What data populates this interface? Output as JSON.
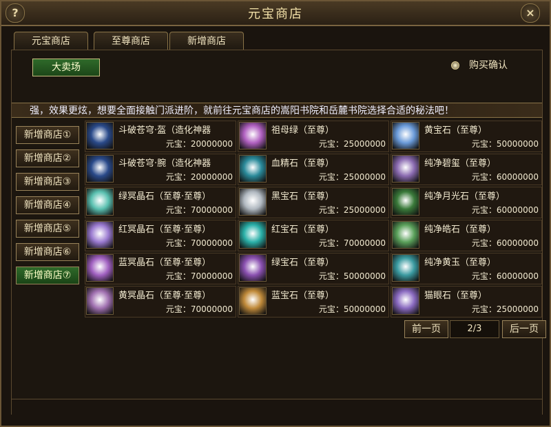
{
  "window": {
    "title": "元宝商店",
    "help_label": "?",
    "close_label": "×"
  },
  "tabs": [
    {
      "label": "元宝商店"
    },
    {
      "label": "至尊商店"
    },
    {
      "label": "新增商店"
    }
  ],
  "market_button": "大卖场",
  "purchase_confirm": "购买确认",
  "banner": "强，效果更炫，想要全面接触门派进阶，就前往元宝商店的嵩阳书院和岳麓书院选择合适的秘法吧！",
  "side_menu": [
    {
      "label": "新增商店①"
    },
    {
      "label": "新增商店②"
    },
    {
      "label": "新增商店③"
    },
    {
      "label": "新增商店④"
    },
    {
      "label": "新增商店⑤"
    },
    {
      "label": "新增商店⑥"
    },
    {
      "label": "新增商店⑦",
      "active": true
    }
  ],
  "items": [
    {
      "name": "斗破苍穹·盔（造化神器",
      "price": "元宝：20000000",
      "icon": "helmet-icon",
      "color": "#2a4a8a"
    },
    {
      "name": "祖母绿（至尊）",
      "price": "元宝：25000000",
      "icon": "gem-icon",
      "color": "#b060c0"
    },
    {
      "name": "黄宝石（至尊）",
      "price": "元宝：50000000",
      "icon": "gem-icon",
      "color": "#6a9ad8"
    },
    {
      "name": "斗破苍穹·腕（造化神器",
      "price": "元宝：20000000",
      "icon": "bracer-icon",
      "color": "#2a4a8a"
    },
    {
      "name": "血精石（至尊）",
      "price": "元宝：25000000",
      "icon": "gem-icon",
      "color": "#2a8a9a"
    },
    {
      "name": "纯净碧玺（至尊）",
      "price": "元宝：60000000",
      "icon": "gem-icon",
      "color": "#8a6ab0"
    },
    {
      "name": "绿冥晶石（至尊·至尊）",
      "price": "元宝：70000000",
      "icon": "crystal-icon",
      "color": "#5ac0b0"
    },
    {
      "name": "黑宝石（至尊）",
      "price": "元宝：25000000",
      "icon": "gem-icon",
      "color": "#b0b8c0"
    },
    {
      "name": "纯净月光石（至尊）",
      "price": "元宝：60000000",
      "icon": "feather-icon",
      "color": "#3a7a3a"
    },
    {
      "name": "红冥晶石（至尊·至尊）",
      "price": "元宝：70000000",
      "icon": "crystal-icon",
      "color": "#9a7ad0"
    },
    {
      "name": "红宝石（至尊）",
      "price": "元宝：70000000",
      "icon": "gem-icon",
      "color": "#2ab0a8"
    },
    {
      "name": "纯净皓石（至尊）",
      "price": "元宝：60000000",
      "icon": "gem-icon",
      "color": "#5aa05a"
    },
    {
      "name": "蓝冥晶石（至尊·至尊）",
      "price": "元宝：70000000",
      "icon": "crystal-icon",
      "color": "#a060c0"
    },
    {
      "name": "绿宝石（至尊）",
      "price": "元宝：50000000",
      "icon": "gem-icon",
      "color": "#8a50b0"
    },
    {
      "name": "纯净黄玉（至尊）",
      "price": "元宝：60000000",
      "icon": "gem-icon",
      "color": "#3a9aa0"
    },
    {
      "name": "黄冥晶石（至尊·至尊）",
      "price": "元宝：70000000",
      "icon": "crystal-icon",
      "color": "#a070b0"
    },
    {
      "name": "蓝宝石（至尊）",
      "price": "元宝：50000000",
      "icon": "gem-icon",
      "color": "#c08a3a"
    },
    {
      "name": "猫眼石（至尊）",
      "price": "元宝：25000000",
      "icon": "gem-icon",
      "color": "#8a6ac0"
    }
  ],
  "pager": {
    "prev": "前一页",
    "page": "2/3",
    "next": "后一页"
  }
}
